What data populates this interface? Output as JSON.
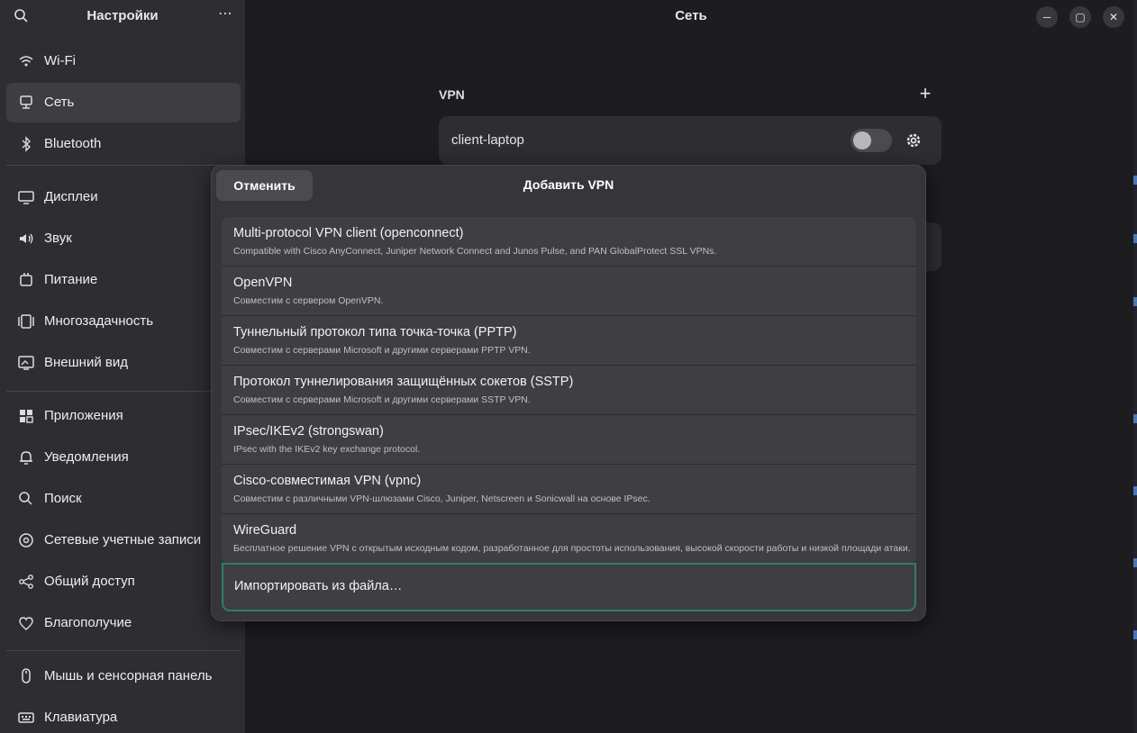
{
  "sidebar": {
    "title": "Настройки",
    "items": [
      {
        "label": "Wi-Fi",
        "icon": "wifi-icon"
      },
      {
        "label": "Сеть",
        "icon": "network-icon"
      },
      {
        "label": "Bluetooth",
        "icon": "bluetooth-icon"
      },
      {
        "label": "Дисплеи",
        "icon": "display-icon"
      },
      {
        "label": "Звук",
        "icon": "sound-icon"
      },
      {
        "label": "Питание",
        "icon": "power-icon"
      },
      {
        "label": "Многозадачность",
        "icon": "multitasking-icon"
      },
      {
        "label": "Внешний вид",
        "icon": "appearance-icon"
      },
      {
        "label": "Приложения",
        "icon": "apps-icon"
      },
      {
        "label": "Уведомления",
        "icon": "bell-icon"
      },
      {
        "label": "Поиск",
        "icon": "search-icon"
      },
      {
        "label": "Сетевые учетные записи",
        "icon": "at-icon"
      },
      {
        "label": "Общий доступ",
        "icon": "share-icon"
      },
      {
        "label": "Благополучие",
        "icon": "wellbeing-icon"
      },
      {
        "label": "Мышь и сенсорная панель",
        "icon": "mouse-icon"
      },
      {
        "label": "Клавиатура",
        "icon": "keyboard-icon"
      }
    ],
    "active_item": "Сеть"
  },
  "header": {
    "title": "Сеть"
  },
  "vpn": {
    "heading": "VPN",
    "connection_name": "client-laptop",
    "connected": false
  },
  "dialog": {
    "title": "Добавить VPN",
    "cancel_label": "Отменить",
    "options": [
      {
        "title": "Multi-protocol VPN client (openconnect)",
        "desc": "Compatible with Cisco AnyConnect, Juniper Network Connect and Junos Pulse, and PAN GlobalProtect SSL VPNs."
      },
      {
        "title": "OpenVPN",
        "desc": "Совместим с сервером OpenVPN."
      },
      {
        "title": "Туннельный протокол типа точка-точка (PPTP)",
        "desc": "Совместим с серверами Microsoft и другими серверами PPTP VPN."
      },
      {
        "title": "Протокол туннелирования защищённых сокетов (SSTP)",
        "desc": "Совместим с серверами Microsoft и другими серверами SSTP VPN."
      },
      {
        "title": "IPsec/IKEv2 (strongswan)",
        "desc": "IPsec with the IKEv2 key exchange protocol."
      },
      {
        "title": "Cisco-совместимая VPN (vpnc)",
        "desc": "Совместим с различными VPN-шлюзами Cisco, Juniper, Netscreen и Sonicwall на основе IPsec."
      },
      {
        "title": "WireGuard",
        "desc": "Бесплатное решение VPN с открытым исходным кодом, разработанное для простоты использования, высокой скорости работы и низкой площади атаки."
      }
    ],
    "import_label": "Импортировать из файла…"
  },
  "colors": {
    "focus_border": "#2f7d6a",
    "sidebar_bg": "#2e2e32",
    "window_bg": "#1d1d20"
  }
}
